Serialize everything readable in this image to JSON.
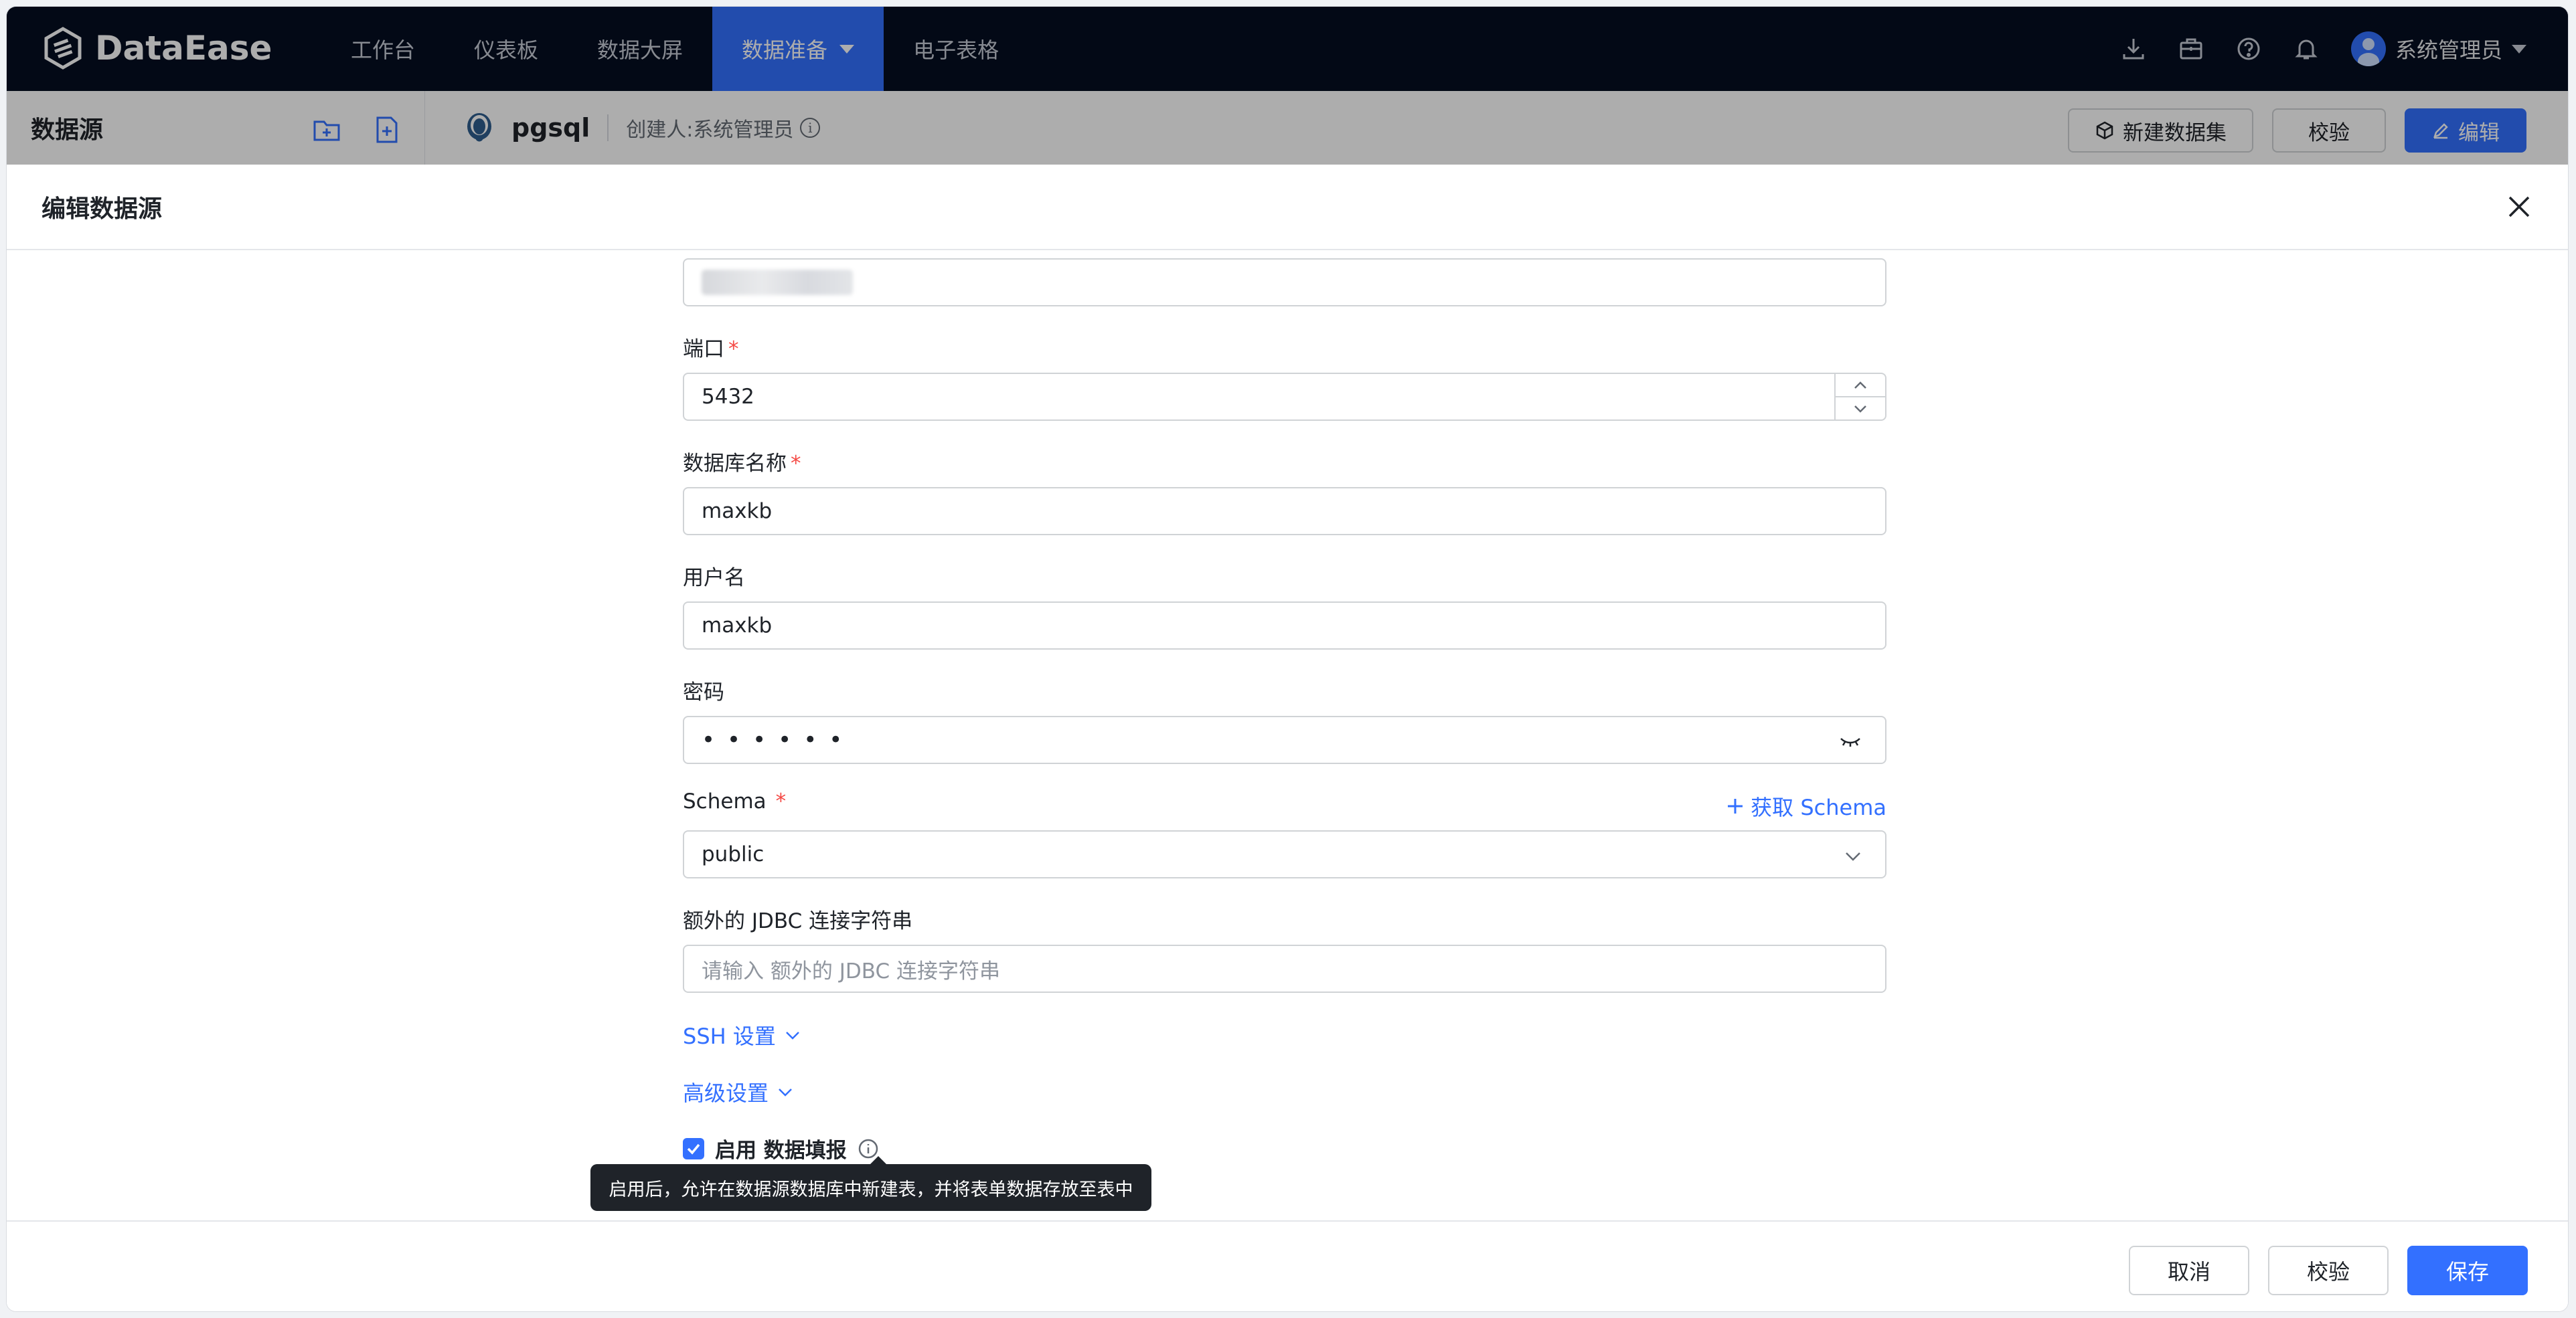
{
  "brand": {
    "name": "DataEase"
  },
  "nav": {
    "items": [
      {
        "label": "工作台"
      },
      {
        "label": "仪表板"
      },
      {
        "label": "数据大屏"
      },
      {
        "label": "数据准备"
      },
      {
        "label": "电子表格"
      }
    ],
    "active_index": 3,
    "user_name": "系统管理员"
  },
  "left_panel": {
    "title": "数据源"
  },
  "datasource": {
    "name": "pgsql",
    "creator": "创建人:系统管理员"
  },
  "header_buttons": {
    "new_dataset": "新建数据集",
    "validate": "校验",
    "edit": "编辑"
  },
  "drawer": {
    "title": "编辑数据源",
    "fields": {
      "port_label": "端口",
      "port_value": "5432",
      "dbname_label": "数据库名称",
      "dbname_value": "maxkb",
      "username_label": "用户名",
      "username_value": "maxkb",
      "password_label": "密码",
      "password_mask": "••••••",
      "schema_label": "Schema",
      "schema_value": "public",
      "get_schema_link": "获取 Schema",
      "jdbc_label": "额外的 JDBC 连接字符串",
      "jdbc_placeholder": "请输入 额外的 JDBC 连接字符串"
    },
    "ssh_settings": "SSH 设置",
    "advanced_settings": "高级设置",
    "enable_fill": {
      "label": "启用 数据填报",
      "checked": true
    },
    "tooltip": "启用后，允许在数据源数据库中新建表，并将表单数据存放至表中",
    "footer": {
      "cancel": "取消",
      "validate": "校验",
      "save": "保存"
    }
  },
  "colors": {
    "nav_bg": "#050e21",
    "accent": "#3370ff",
    "required": "#f54a45"
  }
}
